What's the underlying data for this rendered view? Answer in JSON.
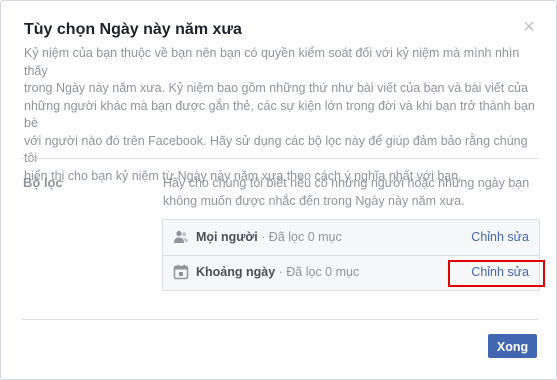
{
  "dialog": {
    "title": "Tùy chọn Ngày này năm xưa",
    "close_glyph": "×",
    "description": "Kỷ niệm của bạn thuộc về bạn nên bạn có quyền kiểm soát đối với kỷ niệm mà mình nhìn thấy\ntrong Ngày này năm xưa. Kỷ niệm bao gồm những thứ như bài viết của bạn và bài viết của\nnhững người khác mà bạn được gắn thẻ, các sự kiện lớn trong đời và khi bạn trở thành bạn bè\nvới người nào đó trên Facebook. Hãy sử dụng các bộ lọc này để giúp đảm bảo rằng chúng tôi\nhiển thị cho bạn kỷ niệm từ Ngày này năm xưa theo cách ý nghĩa nhất với bạn."
  },
  "filters": {
    "label": "Bộ lọc",
    "description": "Hãy cho chúng tôi biết nếu có những người hoặc những ngày bạn\nkhông muốn được nhắc đến trong Ngày này năm xưa.",
    "rows": [
      {
        "icon": "people-icon",
        "name": "Mọi người",
        "status": " · Đã lọc 0 mục",
        "edit_label": "Chỉnh sửa"
      },
      {
        "icon": "calendar-icon",
        "name": "Khoảng ngày",
        "status": " · Đã lọc 0 mục",
        "edit_label": "Chỉnh sửa"
      }
    ]
  },
  "footer": {
    "done_label": "Xong"
  },
  "colors": {
    "accent": "#4267b2",
    "highlight": "#e00000"
  }
}
